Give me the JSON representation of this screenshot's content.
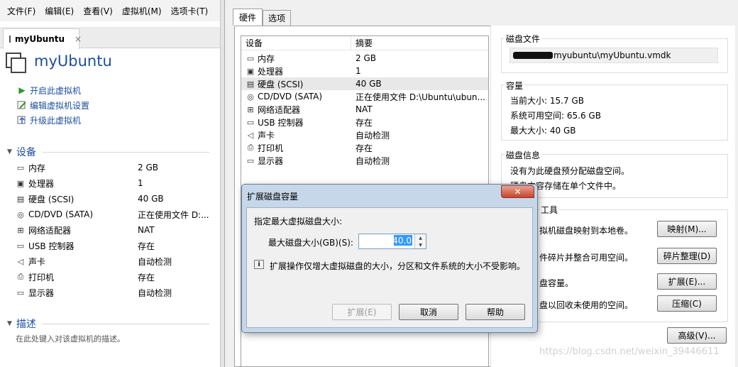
{
  "menu": [
    "文件(F)",
    "编辑(E)",
    "查看(V)",
    "虚拟机(M)",
    "选项卡(T)"
  ],
  "left_tab": {
    "label": "myUbuntu",
    "close": "×"
  },
  "vm_title": "myUbuntu",
  "actions": [
    "开启此虚拟机",
    "编辑虚拟机设置",
    "升级此虚拟机"
  ],
  "devices_section": "设备",
  "hardware": [
    {
      "icon": "memory-icon",
      "label": "内存",
      "value": "2 GB"
    },
    {
      "icon": "cpu-icon",
      "label": "处理器",
      "value": "1"
    },
    {
      "icon": "harddisk-icon",
      "label": "硬盘 (SCSI)",
      "value": "40 GB"
    },
    {
      "icon": "cdrom-icon",
      "label": "CD/DVD (SATA)",
      "value": "正在使用文件 D:..."
    },
    {
      "icon": "network-icon",
      "label": "网络适配器",
      "value": "NAT"
    },
    {
      "icon": "usb-icon",
      "label": "USB 控制器",
      "value": "存在"
    },
    {
      "icon": "sound-icon",
      "label": "声卡",
      "value": "自动检测"
    },
    {
      "icon": "printer-icon",
      "label": "打印机",
      "value": "存在"
    },
    {
      "icon": "display-icon",
      "label": "显示器",
      "value": "自动检测"
    }
  ],
  "description_section": "描述",
  "description_placeholder": "在此处键入对该虚拟机的描述。",
  "settings_tabs": [
    "硬件",
    "选项"
  ],
  "device_list": {
    "headers": [
      "设备",
      "摘要"
    ],
    "rows": [
      {
        "icon": "memory-icon",
        "label": "内存",
        "value": "2 GB"
      },
      {
        "icon": "cpu-icon",
        "label": "处理器",
        "value": "1"
      },
      {
        "icon": "harddisk-icon",
        "label": "硬盘 (SCSI)",
        "value": "40 GB",
        "selected": true
      },
      {
        "icon": "cdrom-icon",
        "label": "CD/DVD (SATA)",
        "value": "正在使用文件 D:\\Ubuntu\\ubun..."
      },
      {
        "icon": "network-icon",
        "label": "网络适配器",
        "value": "NAT"
      },
      {
        "icon": "usb-icon",
        "label": "USB 控制器",
        "value": "存在"
      },
      {
        "icon": "sound-icon",
        "label": "声卡",
        "value": "自动检测"
      },
      {
        "icon": "printer-icon",
        "label": "打印机",
        "value": "存在"
      },
      {
        "icon": "display-icon",
        "label": "显示器",
        "value": "自动检测"
      }
    ]
  },
  "disk_file": {
    "label": "磁盘文件",
    "value": "myubuntu\\myUbuntu.vmdk"
  },
  "capacity": {
    "label": "容量",
    "current": "当前大小: 15.7 GB",
    "available": "系统可用空间: 65.6 GB",
    "max": "最大大小: 40 GB"
  },
  "disk_info": {
    "label": "磁盘信息",
    "line1": "没有为此硬盘预分配磁盘空间。",
    "line2": "硬盘内容存储在单个文件中。"
  },
  "utilities": {
    "label": "工具",
    "map_text": "拟机磁盘映射到本地卷。",
    "map_button": "映射(M)...",
    "defrag_text": "件碎片并整合可用空间。",
    "defrag_button": "碎片整理(D)",
    "expand_text": "盘容量。",
    "expand_button": "扩展(E)...",
    "compact_text": "盘以回收未使用的空间。",
    "compact_button": "压缩(C)"
  },
  "advanced_button": "高级(V)...",
  "dialog": {
    "title": "扩展磁盘容量",
    "close": "✕",
    "prompt": "指定最大虚拟磁盘大小:",
    "size_label": "最大磁盘大小(GB)(S):",
    "size_value": "40.0",
    "info": "扩展操作仅增大虚拟磁盘的大小，分区和文件系统的大小不受影响。",
    "expand_button": "扩展(E)",
    "cancel_button": "取消",
    "help_button": "帮助"
  },
  "watermark": "https://blog.csdn.net/weixin_39446611"
}
